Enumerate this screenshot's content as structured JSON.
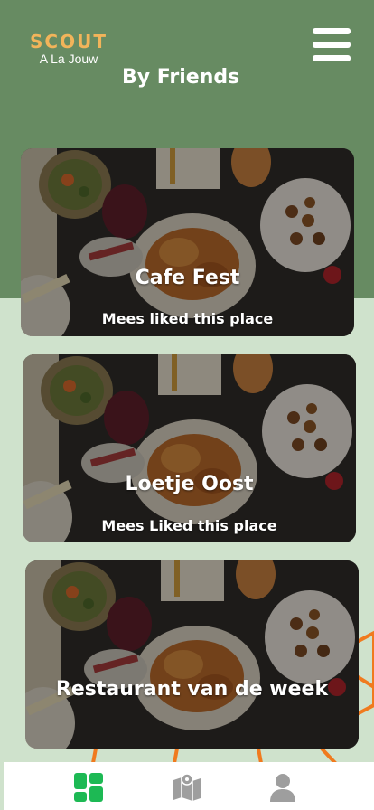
{
  "brand": {
    "name": "SCOUT",
    "subtitle": "A La Jouw"
  },
  "header": {
    "title": "By Friends"
  },
  "cards": [
    {
      "title": "Cafe Fest",
      "subtitle": "Mees liked this place"
    },
    {
      "title": "Loetje Oost",
      "subtitle": "Mees Liked this place"
    },
    {
      "title": "Restaurant van de week",
      "subtitle": ""
    }
  ],
  "nav": {
    "items": [
      {
        "icon": "dashboard-grid-icon",
        "active": true
      },
      {
        "icon": "map-icon",
        "active": false
      },
      {
        "icon": "user-icon",
        "active": false
      }
    ]
  },
  "colors": {
    "header_green": "#678b62",
    "background_green": "#cfe2cc",
    "brand_accent": "#f2b45a",
    "nav_active": "#1db954",
    "nav_inactive": "#9e9e9e",
    "decoration_orange": "#f07a1e"
  }
}
